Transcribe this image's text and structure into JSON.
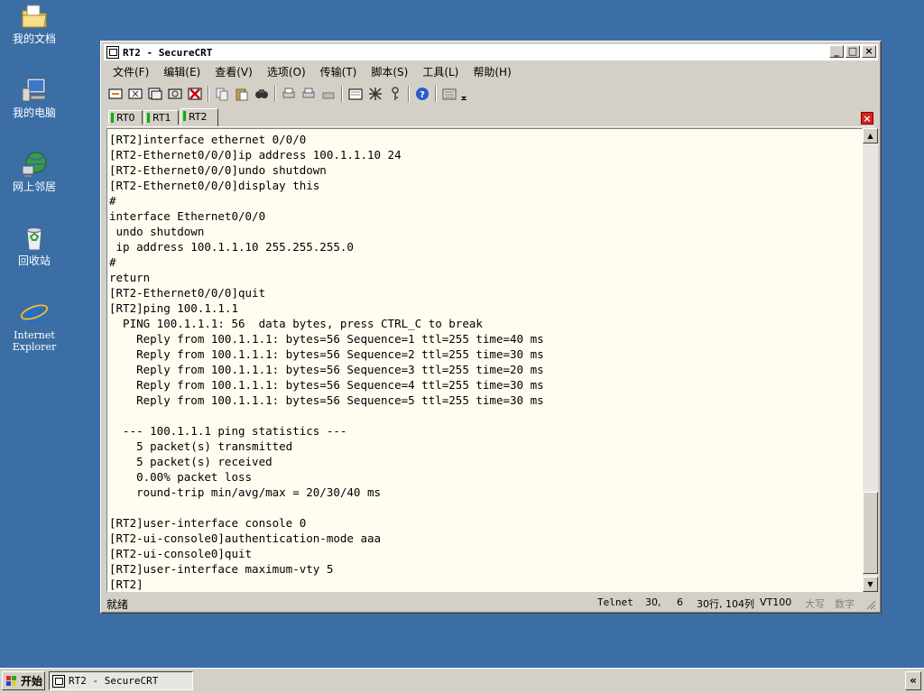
{
  "desktop": {
    "icons": [
      {
        "label": "我的文档",
        "icon": "my-documents-icon"
      },
      {
        "label": "我的电脑",
        "icon": "my-computer-icon"
      },
      {
        "label": "网上邻居",
        "icon": "network-places-icon"
      },
      {
        "label": "回收站",
        "icon": "recycle-bin-icon"
      },
      {
        "label": "Internet\nExplorer",
        "icon": "internet-explorer-icon"
      }
    ]
  },
  "window": {
    "title": "RT2 - SecureCRT",
    "controls": {
      "minimize": "_",
      "maximize": "□",
      "close": "×"
    }
  },
  "menu": [
    "文件(F)",
    "编辑(E)",
    "查看(V)",
    "选项(O)",
    "传输(T)",
    "脚本(S)",
    "工具(L)",
    "帮助(H)"
  ],
  "tabs": [
    {
      "label": "RT0",
      "active": false
    },
    {
      "label": "RT1",
      "active": false
    },
    {
      "label": "RT2",
      "active": true
    }
  ],
  "terminal": {
    "lines": [
      "[RT2]interface ethernet 0/0/0",
      "[RT2-Ethernet0/0/0]ip address 100.1.1.10 24",
      "[RT2-Ethernet0/0/0]undo shutdown",
      "[RT2-Ethernet0/0/0]display this",
      "#",
      "interface Ethernet0/0/0",
      " undo shutdown",
      " ip address 100.1.1.10 255.255.255.0",
      "#",
      "return",
      "[RT2-Ethernet0/0/0]quit",
      "[RT2]ping 100.1.1.1",
      "  PING 100.1.1.1: 56  data bytes, press CTRL_C to break",
      "    Reply from 100.1.1.1: bytes=56 Sequence=1 ttl=255 time=40 ms",
      "    Reply from 100.1.1.1: bytes=56 Sequence=2 ttl=255 time=30 ms",
      "    Reply from 100.1.1.1: bytes=56 Sequence=3 ttl=255 time=20 ms",
      "    Reply from 100.1.1.1: bytes=56 Sequence=4 ttl=255 time=30 ms",
      "    Reply from 100.1.1.1: bytes=56 Sequence=5 ttl=255 time=30 ms",
      "",
      "  --- 100.1.1.1 ping statistics ---",
      "    5 packet(s) transmitted",
      "    5 packet(s) received",
      "    0.00% packet loss",
      "    round-trip min/avg/max = 20/30/40 ms",
      "",
      "[RT2]user-interface console 0",
      "[RT2-ui-console0]authentication-mode aaa",
      "[RT2-ui-console0]quit",
      "[RT2]user-interface maximum-vty 5",
      "[RT2]"
    ]
  },
  "status": {
    "ready": "就绪",
    "protocol": "Telnet",
    "row": "30,",
    "col": "6",
    "size": "30行, 104列",
    "emulation": "VT100",
    "caps": "大写",
    "num": "数字"
  },
  "taskbar": {
    "start": "开始",
    "task": "RT2 - SecureCRT",
    "tray": "«"
  },
  "colors": {
    "desktop": "#3a6ea5",
    "terminal_bg": "#fffdf0",
    "tab_indicator": "#00b000",
    "close_tab": "#d9251c"
  }
}
